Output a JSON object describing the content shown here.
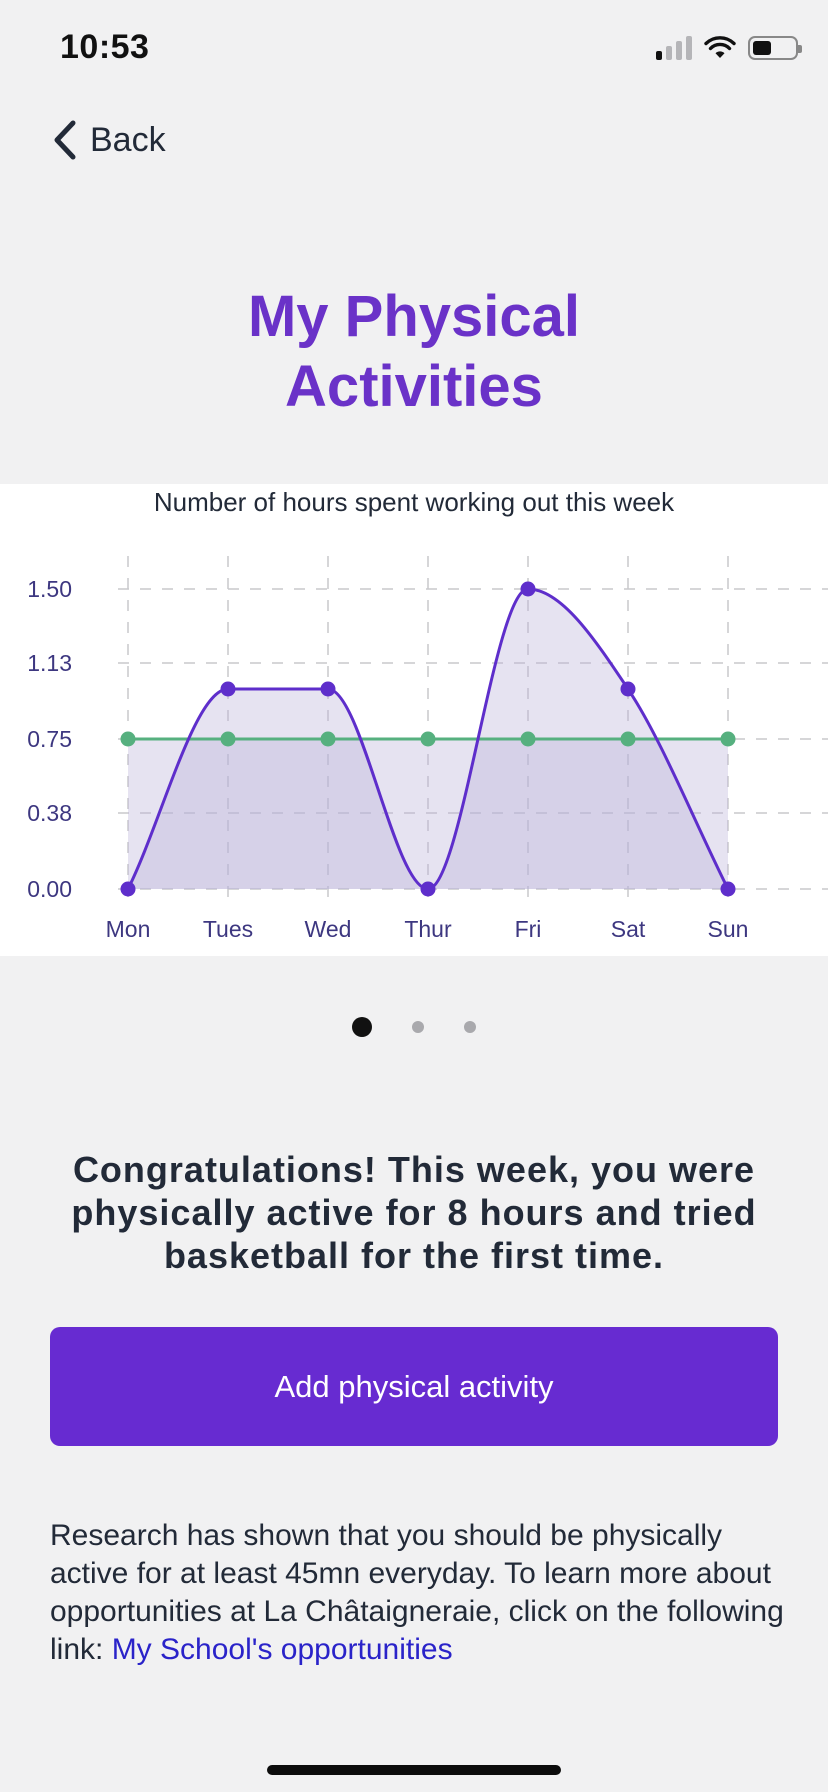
{
  "status_bar": {
    "time": "10:53",
    "signal_bars": 1,
    "battery_level": 0.35
  },
  "nav": {
    "back_label": "Back"
  },
  "page": {
    "title_line1": "My Physical",
    "title_line2": "Activities"
  },
  "chart_data": {
    "type": "line",
    "title": "Number of hours spent working out this week",
    "categories": [
      "Mon",
      "Tues",
      "Wed",
      "Thur",
      "Fri",
      "Sat",
      "Sun"
    ],
    "y_ticks": [
      "0.00",
      "0.38",
      "0.75",
      "1.13",
      "1.50"
    ],
    "ylim": [
      0,
      1.5
    ],
    "grid": true,
    "series": [
      {
        "values": [
          0,
          1,
          1,
          0,
          1.5,
          1,
          0
        ],
        "color": "#5e2ecb",
        "fill": "rgba(182,176,214,0.35)",
        "smooth": true
      },
      {
        "values": [
          0.75,
          0.75,
          0.75,
          0.75,
          0.75,
          0.75,
          0.75
        ],
        "color": "#56b07f",
        "fill": "rgba(182,176,214,0.35)",
        "smooth": false
      }
    ]
  },
  "carousel": {
    "pages": 3,
    "active_index": 0
  },
  "message": {
    "congrats": "Congratulations! This week, you were physically active for 8 hours and tried basketball for the first time."
  },
  "actions": {
    "add_label": "Add physical activity"
  },
  "info": {
    "text": "Research has shown that you should be physically active for at least 45mn everyday. To learn more about opportunities at La Châtaigneraie, click on the following link: ",
    "link_label": "My School's opportunities"
  },
  "colors": {
    "accent": "#6a32c8",
    "button": "#672bd1",
    "link": "#2a23c9",
    "goal_line": "#56b07f"
  }
}
